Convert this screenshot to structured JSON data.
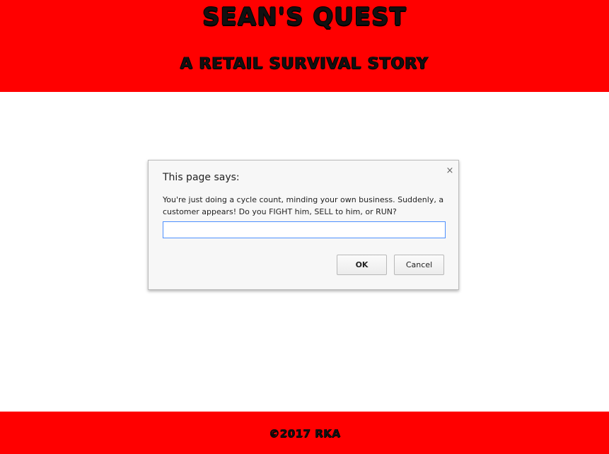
{
  "page": {
    "title": "SEAN'S QUEST",
    "subtitle": "A RETAIL SURVIVAL STORY",
    "footer": "©2017 RKA"
  },
  "dialog": {
    "title": "This page says:",
    "message": "You're just doing a cycle count, minding your own business.  Suddenly, a customer appears! Do you FIGHT him, SELL to him, or RUN?",
    "input_value": "",
    "close_icon": "close-icon",
    "ok_label": "OK",
    "cancel_label": "Cancel"
  },
  "colors": {
    "brand_red": "#ff0000",
    "text_dark": "#111111",
    "focus_blue": "#4d90fe"
  }
}
